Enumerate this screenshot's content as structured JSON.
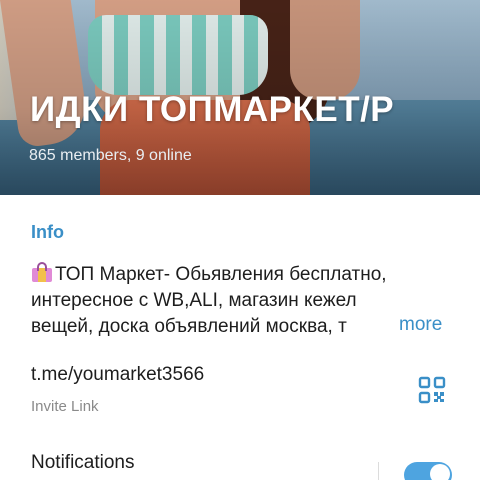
{
  "header": {
    "title": "ИДКИ   ТОПМАРКЕТ/Р",
    "subtitle": "865 members, 9 online",
    "photo_icon": "profile-photo"
  },
  "info": {
    "heading": "Info",
    "description_lines": [
      "ТОП Маркет- Обьявления бесплатно,",
      "интересное с WB,ALI,  магазин кежел",
      "вещей,  доска объявлений москва, т"
    ],
    "description_emoji_icon": "shopping-bags-icon",
    "more_label": "more",
    "link": "t.me/youmarket3566",
    "link_caption": "Invite Link",
    "qr_icon": "qr-code-icon",
    "notifications_label": "Notifications",
    "notifications_enabled": true
  },
  "colors": {
    "accent": "#3a8fc7",
    "toggle_on": "#4ea4e0",
    "text_primary": "#1d1d1d",
    "text_secondary": "#8a8a8a"
  }
}
